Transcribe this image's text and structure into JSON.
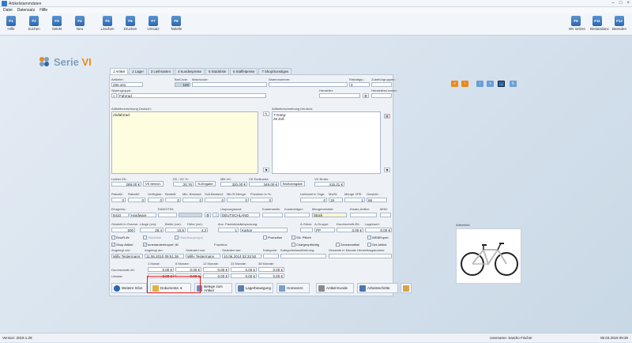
{
  "window": {
    "title": "Artikelstammdaten"
  },
  "menu": [
    "Datei",
    "Datensatz",
    "Hilfe"
  ],
  "toolbar_left": [
    {
      "key": "F1",
      "label": "Hilfe"
    },
    {
      "key": "F2",
      "label": "Suchen"
    },
    {
      "key": "F3",
      "label": "Selekt"
    },
    {
      "key": "F4",
      "label": "Neu"
    },
    {
      "key": "F5",
      "label": "Löschen"
    },
    {
      "key": "F6",
      "label": "Drucken"
    },
    {
      "key": "F7",
      "label": "Umsatz"
    },
    {
      "key": "F8",
      "label": "Tabelle"
    }
  ],
  "toolbar_right": [
    {
      "key": "F9",
      "label": "Wv setzen"
    },
    {
      "key": "F11",
      "label": "Bestandanz."
    },
    {
      "key": "F12",
      "label": "Beenden"
    }
  ],
  "logo": {
    "text1": "Serie",
    "text2": "VI"
  },
  "tabs": [
    "1 Artikel",
    "2 Lager",
    "3 Lieferanten",
    "4 Kundenpreise",
    "5 Stückliste",
    "6 Staffelpreise",
    "7 Shop/Sonstiges"
  ],
  "form": {
    "artikelnr_label": "Artikelnr.:",
    "artikelnr": "250.101",
    "barcode_label": "BarCode:",
    "barcode": "100",
    "matchcode_label": "Matchcode:",
    "warenummer_label": "Warennummer:",
    "rabattgrp_label": "Rabattgrp.:",
    "rabattgrp": "0",
    "zubehoer_label": "Zubehörgruppen:",
    "warengruppe_label": "Warengruppe:",
    "warengruppe": "Fahrrad",
    "hersteller_label": "Hersteller:",
    "herstellernr_label": "Herstellernummer:",
    "bez_de_label": "Artikelbezeichnung Deutsch:",
    "bez_de": "Alufahrrad",
    "beschr_de_label": "Artikelbeschreibung Deutsch:",
    "beschr_lines": [
      "7-Gang-",
      "28 Zoll"
    ],
    "ek_label": "Letzter EK:",
    "ek": "289,00 €",
    "vk_berech": "VK berech.",
    "ek_vk_label": "EK / VK %:",
    "ek_vk": "20,76",
    "eingabe": "%-Eingabe",
    "mittel_label": "Mitt VK:",
    "mittel": "320,00 €",
    "endkunde_label": "VK Endkunde:",
    "endkunde": "349,00 €",
    "brutto": "Bruttoeingabe",
    "vkbrutto_label": "VK Brutto:",
    "vkbrutto": "415,31 €",
    "row_labels": [
      "Rabatt1:",
      "Rabatt2:",
      "Verfügbar:",
      "Bestellt:",
      "Min. Bestand:",
      "Soll-Bestand:",
      "Min.R.Menge:",
      "Provision in %:",
      "Lieferzeit in Tage:",
      "MwSt:",
      "Menge VPE:",
      "Gewicht:"
    ],
    "row_values": [
      "0",
      "0",
      "0",
      "0",
      "0",
      "0",
      "0",
      "0",
      "0",
      "19",
      "1",
      "66"
    ],
    "einrgebnr_label": "Einrgebnr.:",
    "einrgebnr": "8410",
    "hardware": "Hardware",
    "ean_label": "EAN/GTIN:",
    "ursprung_label": "Ursprungsland:",
    "ursprung": "DEUTSCHLAND",
    "kosten_label": "Kostenstelle:",
    "kostentraeger_label": "Kostenträger:",
    "mengeneinheit_label": "Mengeneinheit:",
    "mengeneinheit": "Stück",
    "ersatz_label": "Ersatz-Artikel:",
    "mhd_label": "MHD:",
    "gewicht_label": "Gewicht in Gramm:",
    "gewicht": "500",
    "laenge_label": "Länge (cm):",
    "laenge": "28,4",
    "breite_label": "Breite (cm):",
    "breite": "10,5",
    "hoehe_label": "Höhe (cm):",
    "hoehe": "4,3",
    "anzpak_label": "Anz. Packstücke:",
    "anzpak": "1",
    "verpackung_label": "Verpackung:",
    "verpackung": "Karton",
    "abc_label": "A-Stück:",
    "agruppe_label": "A-Gruppe:",
    "agruppe": "PP",
    "durchschnitt_label": "Durchschnitt-EK:",
    "durchschnitt": "0,00 €",
    "lagerwert_label": "Lagerwert:",
    "lagerwert": "0,00 €",
    "angelegt_label": "Angelegt von:",
    "angelegt": "Willy Testermann",
    "angelegt_am_label": "Angelegt am:",
    "angelegt_am": "11.06.2010 09:51:36",
    "geaendert_label": "Geändert von:",
    "geaendert": "Willy Testermann",
    "geaendert_am_label": "Geändert am:",
    "geaendert_am": "10.06.2014 02:32:52",
    "kategorie_label": "Kategorie:",
    "kategorie_nr_label": "Kategorieklassifizierung:",
    "gesamte_label": "Gesamte in Monate Herstellungskosten:",
    "frachtlos": "Frachtlos",
    "umsatz_headers": [
      "1 Monat:",
      "6 Monate:",
      "12 Monate:",
      "24 Monate:",
      "36 Monate:"
    ],
    "durchschnitt_vk_label": "Durchschnitt-VK:",
    "umsatz_label": "Umsatz:",
    "zero": "0,00 €"
  },
  "checkboxes": [
    {
      "label": "EinzFLife",
      "checked": false
    },
    {
      "label": "Stückliste",
      "checked": false
    },
    {
      "label": "Hauptbaugruppe",
      "checked": false
    },
    {
      "label": "Promotion",
      "checked": false
    },
    {
      "label": "SN. Pflicht",
      "checked": false
    },
    {
      "label": "WEBExport",
      "checked": false
    },
    {
      "label": "Shop Artikel",
      "checked": true
    },
    {
      "label": "Innerlandertexport.:IN",
      "checked": true
    },
    {
      "label": "Chargenpflichtig",
      "checked": false
    },
    {
      "label": "Zensierartikel",
      "checked": false
    },
    {
      "label": "Set-Artikel",
      "checked": false
    }
  ],
  "bottom_buttons": [
    "Weitere Infos",
    "Dokumente",
    "Belege zum Artikel",
    "Lagerbewegung",
    "Homeverz.",
    "Artikel-Kunde",
    "Arbeitsschritte"
  ],
  "artikelbild_label": "Artikelbild:",
  "status": {
    "version": "Version: 2019.1.29",
    "user": "Username: Sandro Fischer",
    "datetime": "08.03.2019 09:36"
  },
  "colors": {
    "accent": "#2c67ad",
    "highlight_box": "#e02020"
  }
}
